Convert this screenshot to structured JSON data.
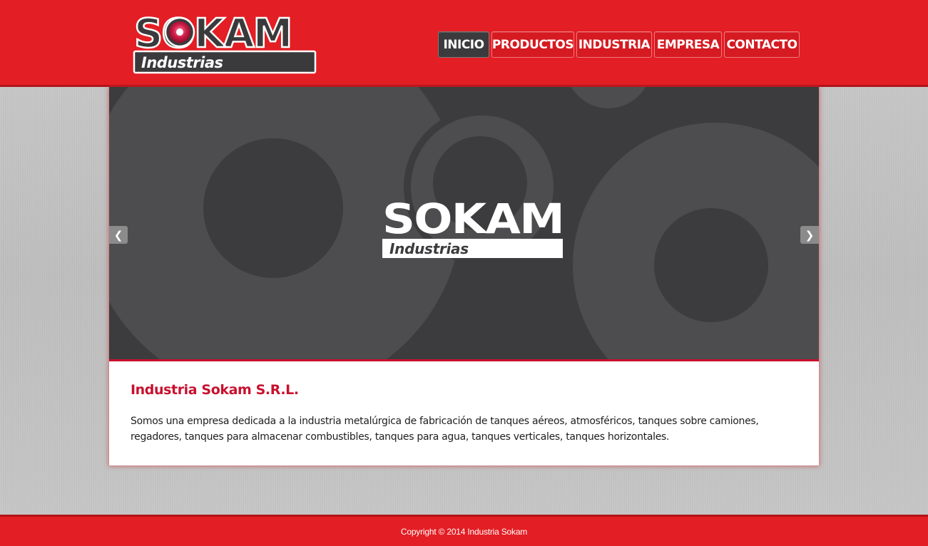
{
  "brand": {
    "name": "SOKAM",
    "subtitle": "Industrias"
  },
  "nav": {
    "items": [
      {
        "label": "INICIO",
        "active": true
      },
      {
        "label": "PRODUCTOS",
        "active": false
      },
      {
        "label": "INDUSTRIA",
        "active": false
      },
      {
        "label": "EMPRESA",
        "active": false
      },
      {
        "label": "CONTACTO",
        "active": false
      }
    ]
  },
  "slider": {
    "prev_icon": "chevron-left-icon",
    "next_icon": "chevron-right-icon",
    "prev_glyph": "❮",
    "next_glyph": "❯",
    "slide_logo_name": "SOKAM",
    "slide_logo_subtitle": "Industrias"
  },
  "main": {
    "title": "Industria Sokam S.R.L.",
    "description": "Somos una empresa dedicada a la industria metalúrgica de fabricación de tanques aéreos, atmosféricos, tanques sobre camiones, regadores, tanques para almacenar combustibles, tanques para agua, tanques verticales, tanques horizontales."
  },
  "footer": {
    "copyright": "Copyright © 2014 Industria Sokam"
  },
  "colors": {
    "brand_red": "#e31e24",
    "accent_red": "#c8102e",
    "dark_gray": "#3b3b3d"
  }
}
